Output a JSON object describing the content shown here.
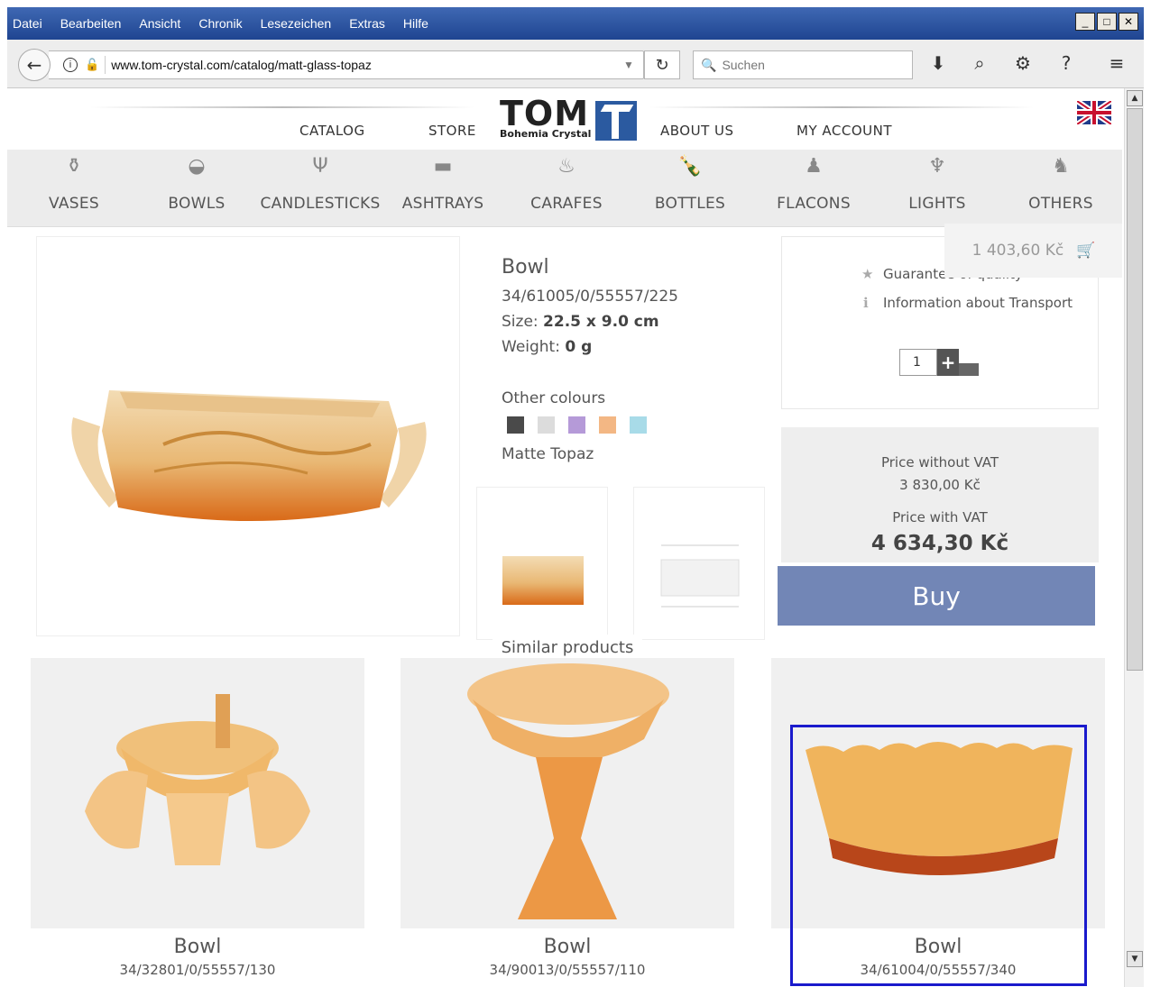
{
  "menubar": {
    "items": [
      "Datei",
      "Bearbeiten",
      "Ansicht",
      "Chronik",
      "Lesezeichen",
      "Extras",
      "Hilfe"
    ],
    "win_minimize": "_",
    "win_maximize": "□",
    "win_close": "✕"
  },
  "toolbar": {
    "url": "www.tom-crystal.com/catalog/matt-glass-topaz",
    "search_placeholder": "Suchen"
  },
  "site": {
    "nav": {
      "catalog": "CATALOG",
      "store": "STORE",
      "about": "ABOUT US",
      "account": "MY ACCOUNT"
    },
    "logo_text": "TOM",
    "logo_sub": "Bohemia Crystal",
    "categories": [
      "VASES",
      "BOWLS",
      "CANDLESTICKS",
      "ASHTRAYS",
      "CARAFES",
      "BOTTLES",
      "FLACONS",
      "LIGHTS",
      "OTHERS"
    ],
    "cart_total": "1 403,60 Kč"
  },
  "product": {
    "title": "Bowl",
    "code": "34/61005/0/55557/225",
    "size_label": "Size:",
    "size_value": "22.5 x 9.0 cm",
    "weight_label": "Weight:",
    "weight_value": "0 g",
    "other_colours_label": "Other colours",
    "colour_name": "Matte Topaz",
    "swatches": [
      "#4a4a4a",
      "#dcdcdc",
      "#b59ad8",
      "#f3b784",
      "#a8dbe8"
    ],
    "guarantee": "Guarantee of quality",
    "transport": "Information about Transport",
    "quantity": "1",
    "price_without_vat_label": "Price without VAT",
    "price_without_vat": "3 830,00 Kč",
    "price_with_vat_label": "Price with VAT",
    "price_with_vat": "4 634,30 Kč",
    "buy_label": "Buy"
  },
  "similar": {
    "label": "Similar products",
    "items": [
      {
        "name": "Bowl",
        "code": "34/32801/0/55557/130"
      },
      {
        "name": "Bowl",
        "code": "34/90013/0/55557/110"
      },
      {
        "name": "Bowl",
        "code": "34/61004/0/55557/340"
      }
    ]
  }
}
